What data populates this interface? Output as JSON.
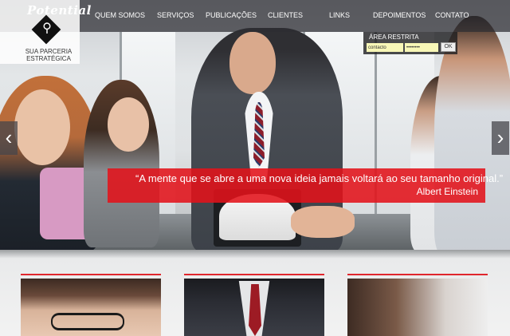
{
  "brand": {
    "logo_text": "Potential",
    "tagline": "SUA PARCERIA ESTRATÉGICA"
  },
  "nav": {
    "items": [
      {
        "label": "QUEM SOMOS"
      },
      {
        "label": "SERVIÇOS"
      },
      {
        "label": "PUBLICAÇÕES"
      },
      {
        "label": "CLIENTES"
      },
      {
        "label": "LINKS"
      },
      {
        "label": "DEPOIMENTOS"
      },
      {
        "label": "CONTATO"
      }
    ]
  },
  "restricted_area": {
    "title": "ÁREA RESTRITA",
    "username_value": "contacto",
    "password_value": "••••••••",
    "submit_label": "OK"
  },
  "hero": {
    "quote": "“A mente que se abre a uma nova ideia jamais voltará ao seu tamanho original.”",
    "author": "Albert Einstein",
    "prev_icon": "chevron-left-icon",
    "next_icon": "chevron-right-icon",
    "quote_bg_color": "#e2121a"
  },
  "cards": {
    "accent_color": "#e0262d"
  }
}
